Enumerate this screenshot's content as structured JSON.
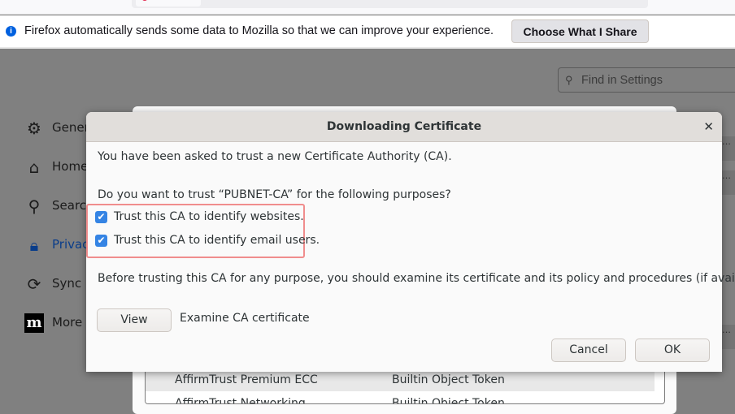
{
  "notification": {
    "message": "Firefox automatically sends some data to Mozilla so that we can improve your experience.",
    "button": "Choose What I Share"
  },
  "search": {
    "placeholder": "Find in Settings"
  },
  "sidebar": {
    "items": [
      {
        "label": "General",
        "icon": "gear-icon"
      },
      {
        "label": "Home",
        "icon": "home-icon"
      },
      {
        "label": "Search",
        "icon": "search-icon"
      },
      {
        "label": "Privacy",
        "icon": "lock-icon",
        "selected": true
      },
      {
        "label": "Sync",
        "icon": "sync-icon"
      },
      {
        "label": "More",
        "icon": "mozilla-icon"
      }
    ]
  },
  "background_table": {
    "rows": [
      [
        "AffirmTrust Premium ECC",
        "Builtin Object Token"
      ],
      [
        "AffirmTrust Networking",
        "Builtin Object Token"
      ]
    ]
  },
  "dialog": {
    "title": "Downloading Certificate",
    "intro": "You have been asked to trust a new Certificate Authority (CA).",
    "question": "Do you want to trust “PUBNET-CA” for the following purposes?",
    "options": [
      {
        "label": "Trust this CA to identify websites.",
        "checked": true
      },
      {
        "label": "Trust this CA to identify email users.",
        "checked": true
      }
    ],
    "advice": "Before trusting this CA for any purpose, you should examine its certificate and its policy and procedures (if available).",
    "view_button": "View",
    "view_label": "Examine CA certificate",
    "cancel": "Cancel",
    "ok": "OK"
  },
  "colors": {
    "accent": "#3584e4",
    "focus": "#f08d8d"
  }
}
